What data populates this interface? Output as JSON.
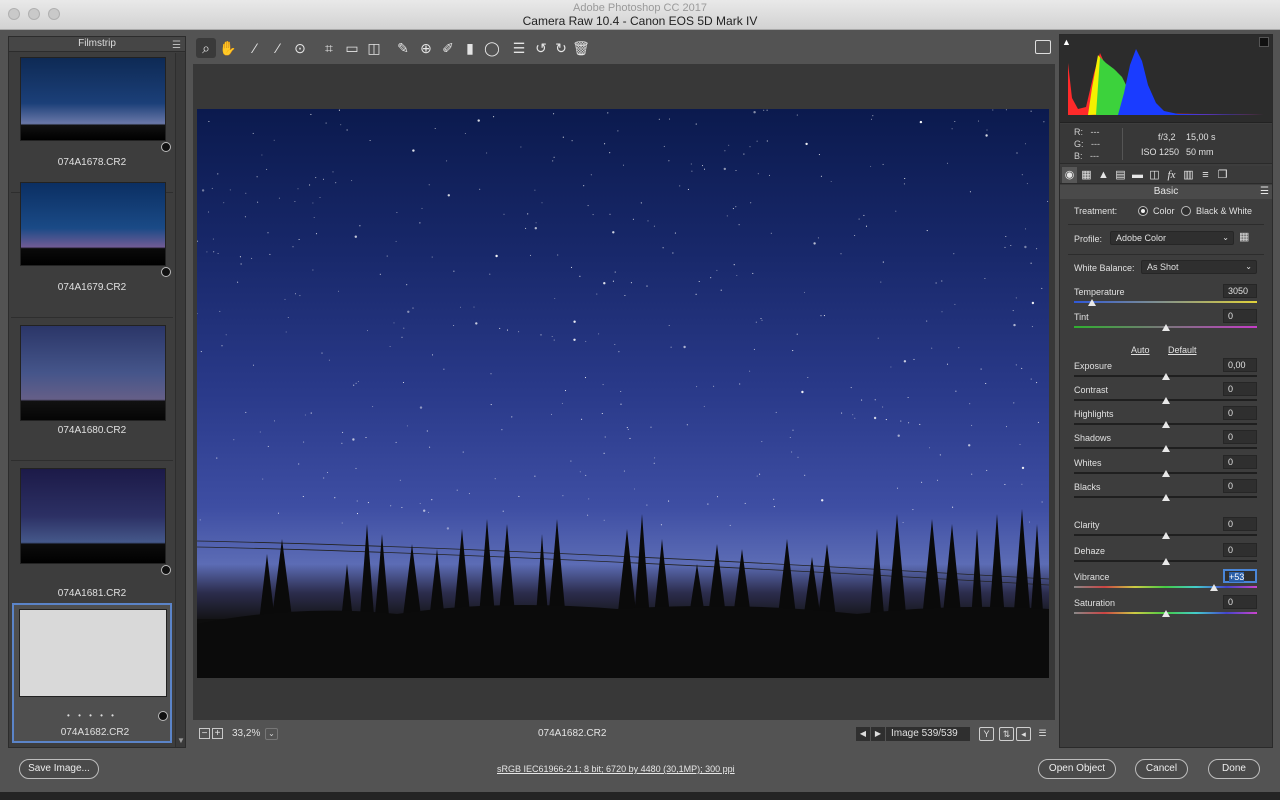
{
  "window": {
    "app_title": "Adobe Photoshop CC 2017",
    "title": "Camera Raw 10.4  -  Canon EOS 5D Mark IV"
  },
  "filmstrip": {
    "header": "Filmstrip",
    "items": [
      {
        "name": "074A1678.CR2",
        "selected": false
      },
      {
        "name": "074A1679.CR2",
        "selected": false
      },
      {
        "name": "074A1680.CR2",
        "selected": false
      },
      {
        "name": "074A1681.CR2",
        "selected": false
      },
      {
        "name": "074A1682.CR2",
        "selected": true,
        "rating": "• • • • •"
      }
    ]
  },
  "toolbar": {
    "tools": [
      "zoom-tool",
      "hand-tool",
      "white-balance-tool",
      "color-sampler-tool",
      "targeted-adjustment-tool",
      "crop-tool",
      "straighten-tool",
      "transform-tool",
      "spot-removal-tool",
      "red-eye-removal-tool",
      "adjustment-brush",
      "graduated-filter",
      "radial-filter",
      "preferences",
      "rotate-left",
      "rotate-right",
      "delete"
    ]
  },
  "preview_bar": {
    "zoom": "33,2%",
    "file_name": "074A1682.CR2",
    "image_count": "Image 539/539"
  },
  "histogram": {
    "clip_colors": {
      "red": "#ff2a2a",
      "yellow": "#f4f000",
      "green": "#3cd23c",
      "cyan": "#38d8e0",
      "blue": "#1a3cff"
    }
  },
  "info": {
    "r_label": "R:",
    "g_label": "G:",
    "b_label": "B:",
    "r_value": "---",
    "g_value": "---",
    "b_value": "---",
    "aperture": "f/3,2",
    "shutter": "15,00 s",
    "iso": "ISO 1250",
    "focal_length": "50 mm"
  },
  "basic": {
    "section_title": "Basic",
    "treatment_label": "Treatment:",
    "treatment_color": "Color",
    "treatment_bw": "Black & White",
    "profile_label": "Profile:",
    "profile_value": "Adobe Color",
    "wb_label": "White Balance:",
    "wb_value": "As Shot",
    "auto_label": "Auto",
    "default_label": "Default",
    "sliders": {
      "temperature": {
        "label": "Temperature",
        "value": "3050",
        "level": 0.1
      },
      "tint": {
        "label": "Tint",
        "value": "0",
        "level": 0.5
      },
      "exposure": {
        "label": "Exposure",
        "value": "0,00",
        "level": 0.5
      },
      "contrast": {
        "label": "Contrast",
        "value": "0",
        "level": 0.5
      },
      "highlights": {
        "label": "Highlights",
        "value": "0",
        "level": 0.5
      },
      "shadows": {
        "label": "Shadows",
        "value": "0",
        "level": 0.5
      },
      "whites": {
        "label": "Whites",
        "value": "0",
        "level": 0.5
      },
      "blacks": {
        "label": "Blacks",
        "value": "0",
        "level": 0.5
      },
      "clarity": {
        "label": "Clarity",
        "value": "0",
        "level": 0.5
      },
      "dehaze": {
        "label": "Dehaze",
        "value": "0",
        "level": 0.5
      },
      "vibrance": {
        "label": "Vibrance",
        "value": "+53",
        "level": 0.765
      },
      "saturation": {
        "label": "Saturation",
        "value": "0",
        "level": 0.5
      }
    }
  },
  "footer": {
    "save_label": "Save Image...",
    "workflow": "sRGB IEC61966-2.1; 8 bit; 6720 by 4480 (30,1MP); 300 ppi",
    "open_label": "Open Object",
    "cancel_label": "Cancel",
    "done_label": "Done"
  }
}
